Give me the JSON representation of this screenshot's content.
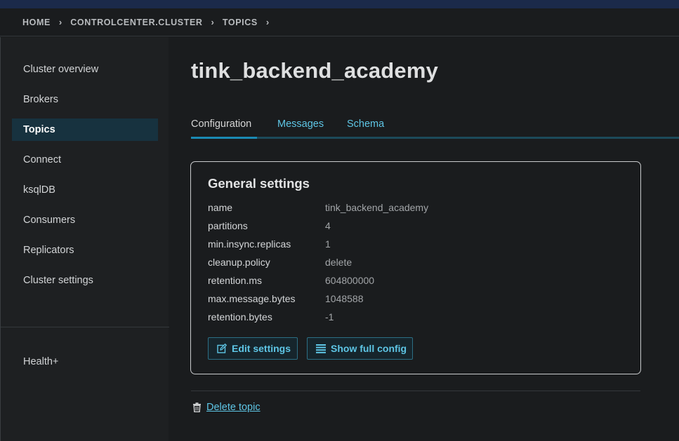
{
  "breadcrumb": {
    "items": [
      "HOME",
      "CONTROLCENTER.CLUSTER",
      "TOPICS"
    ],
    "separator": "›"
  },
  "sidebar": {
    "items": [
      {
        "label": "Cluster overview",
        "active": false
      },
      {
        "label": "Brokers",
        "active": false
      },
      {
        "label": "Topics",
        "active": true
      },
      {
        "label": "Connect",
        "active": false
      },
      {
        "label": "ksqlDB",
        "active": false
      },
      {
        "label": "Consumers",
        "active": false
      },
      {
        "label": "Replicators",
        "active": false
      },
      {
        "label": "Cluster settings",
        "active": false
      }
    ],
    "footer_item": {
      "label": "Health+"
    }
  },
  "page": {
    "title": "tink_backend_academy"
  },
  "tabs": [
    {
      "label": "Configuration",
      "active": true
    },
    {
      "label": "Messages",
      "active": false
    },
    {
      "label": "Schema",
      "active": false
    }
  ],
  "general_settings": {
    "title": "General settings",
    "rows": [
      {
        "key": "name",
        "value": "tink_backend_academy"
      },
      {
        "key": "partitions",
        "value": "4"
      },
      {
        "key": "min.insync.replicas",
        "value": "1"
      },
      {
        "key": "cleanup.policy",
        "value": "delete"
      },
      {
        "key": "retention.ms",
        "value": "604800000"
      },
      {
        "key": "max.message.bytes",
        "value": "1048588"
      },
      {
        "key": "retention.bytes",
        "value": "-1"
      }
    ],
    "edit_button": {
      "label": "Edit settings",
      "icon": "edit-icon"
    },
    "full_config_button": {
      "label": "Show full config",
      "icon": "list-icon"
    }
  },
  "delete": {
    "label": "Delete topic",
    "icon": "trash-icon"
  },
  "colors": {
    "background": "#1a1c1e",
    "accent": "#5ec6e6",
    "active_nav": "#17323f",
    "tab_indicator": "#1a8ab4"
  }
}
